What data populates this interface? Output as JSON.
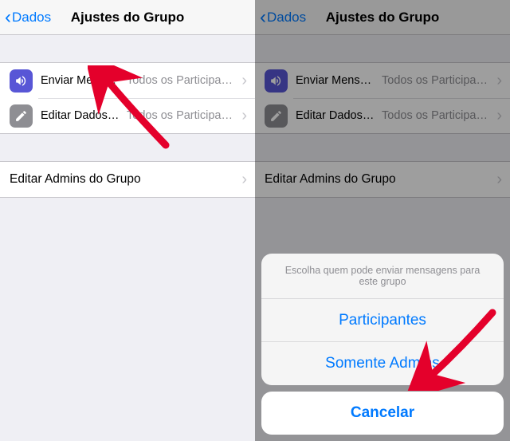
{
  "nav": {
    "back": "Dados",
    "title": "Ajustes do Grupo"
  },
  "rows": {
    "send": {
      "label": "Enviar Mensag…",
      "value": "Todos os Participantes"
    },
    "edit": {
      "label": "Editar Dados do…",
      "value": "Todos os Participantes"
    },
    "admins": {
      "label": "Editar Admins do Grupo"
    }
  },
  "sheet": {
    "message": "Escolha quem pode enviar mensagens para este grupo",
    "opt1": "Participantes",
    "opt2": "Somente Admins",
    "cancel": "Cancelar"
  }
}
